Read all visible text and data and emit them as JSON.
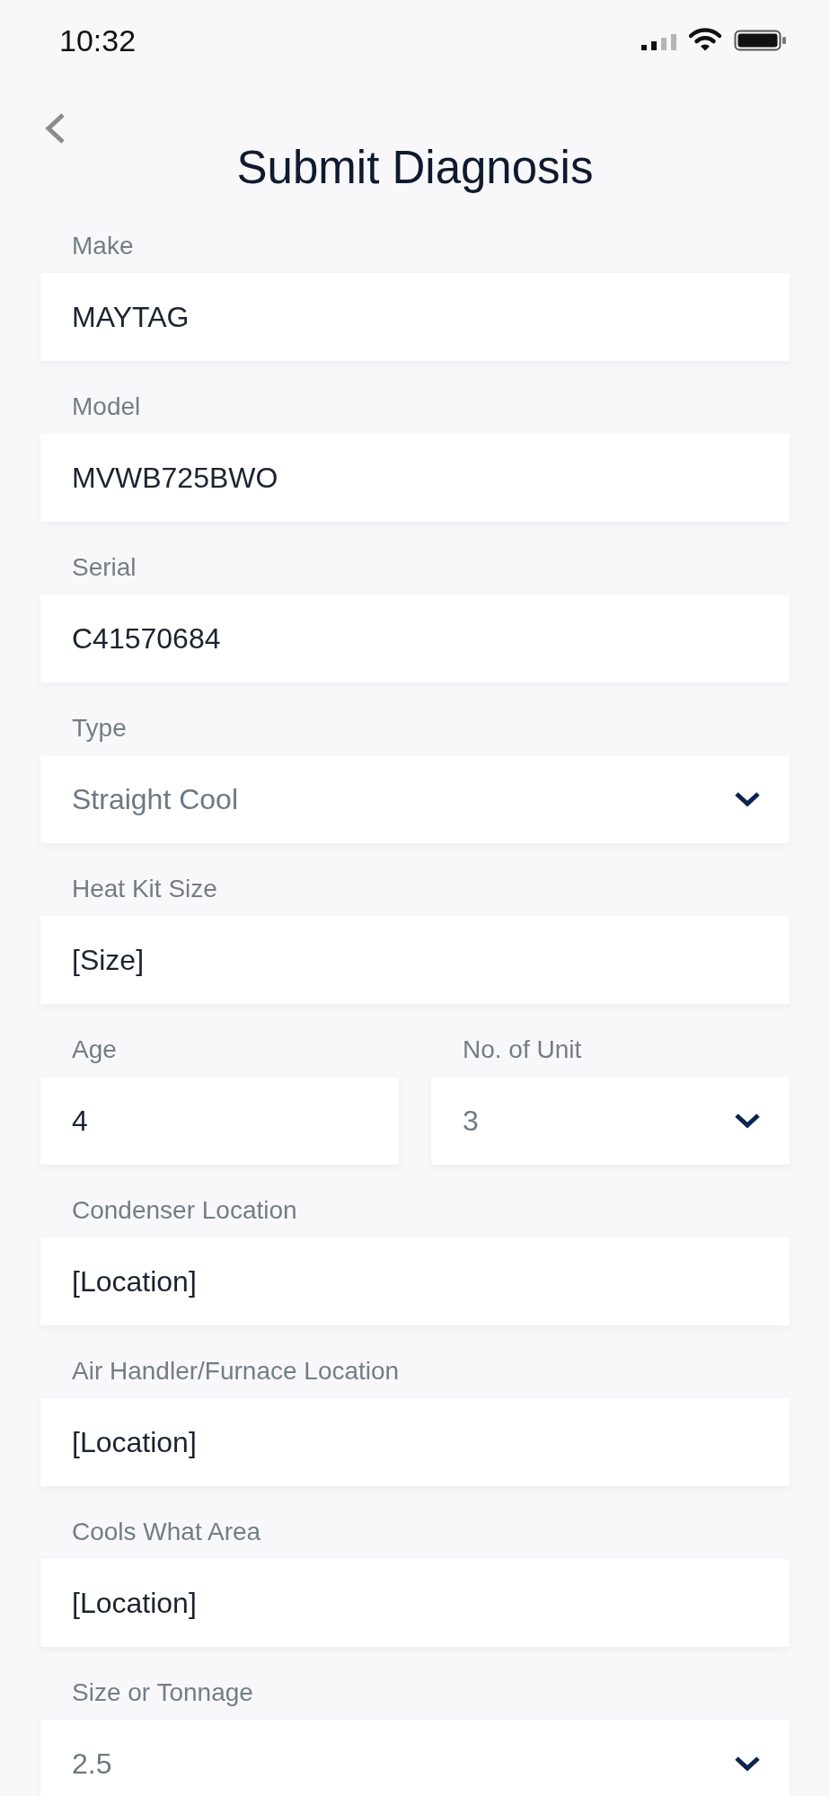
{
  "status_bar": {
    "time": "10:32"
  },
  "header": {
    "title": "Submit Diagnosis"
  },
  "form": {
    "rows": [
      {
        "fields": [
          {
            "kind": "text",
            "label": "Make",
            "value": "MAYTAG"
          }
        ]
      },
      {
        "fields": [
          {
            "kind": "text",
            "label": "Model",
            "value": "MVWB725BWO"
          }
        ]
      },
      {
        "fields": [
          {
            "kind": "text",
            "label": "Serial",
            "value": "C41570684"
          }
        ]
      },
      {
        "fields": [
          {
            "kind": "select",
            "label": "Type",
            "value": "Straight Cool"
          }
        ]
      },
      {
        "fields": [
          {
            "kind": "text",
            "label": "Heat Kit Size",
            "value": "[Size]"
          }
        ]
      },
      {
        "fields": [
          {
            "kind": "text",
            "label": "Age",
            "value": "4"
          },
          {
            "kind": "select",
            "label": "No. of Unit",
            "value": "3"
          }
        ]
      },
      {
        "fields": [
          {
            "kind": "text",
            "label": "Condenser Location",
            "value": "[Location]"
          }
        ]
      },
      {
        "fields": [
          {
            "kind": "text",
            "label": "Air Handler/Furnace Location",
            "value": "[Location]"
          }
        ]
      },
      {
        "fields": [
          {
            "kind": "text",
            "label": "Cools What Area",
            "value": "[Location]"
          }
        ]
      },
      {
        "fields": [
          {
            "kind": "select",
            "label": "Size or Tonnage",
            "value": "2.5"
          }
        ]
      }
    ]
  }
}
